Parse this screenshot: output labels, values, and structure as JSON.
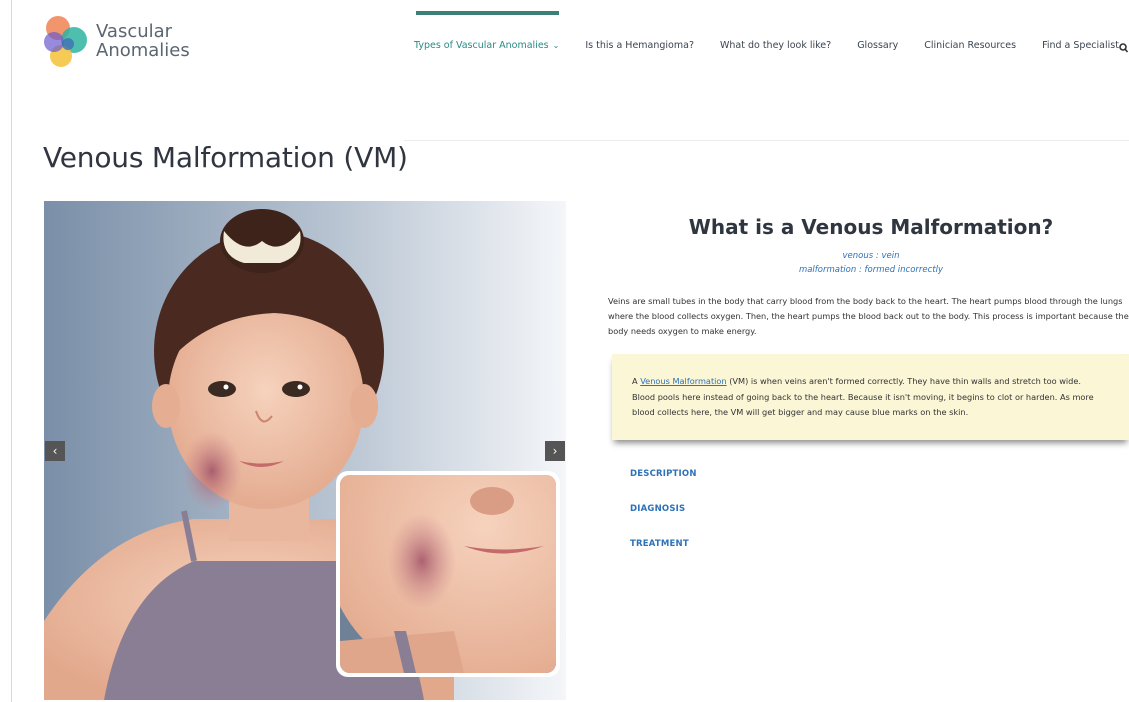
{
  "brand": {
    "line1": "Vascular",
    "line2": "Anomalies"
  },
  "nav": {
    "items": [
      {
        "label": "Types of Vascular Anomalies",
        "active": true,
        "has_caret": true
      },
      {
        "label": "Is this a Hemangioma?"
      },
      {
        "label": "What do they look like?"
      },
      {
        "label": "Glossary"
      },
      {
        "label": "Clinician Resources"
      },
      {
        "label": "Find a Specialist"
      }
    ],
    "search_icon": "search-icon",
    "caret": "⌄"
  },
  "page": {
    "title": "Venous Malformation (VM)"
  },
  "carousel": {
    "prev": "‹",
    "next": "›"
  },
  "content": {
    "heading": "What is a Venous Malformation?",
    "definitions": [
      "venous : vein",
      "malformation : formed incorrectly"
    ],
    "intro": "Veins are small tubes in the body that carry blood from the body back to the heart. The heart pumps blood through the lungs where the blood collects oxygen. Then, the heart pumps the blood back out to the body. This process is important because the body needs oxygen to make energy.",
    "callout": {
      "prefix": "A ",
      "link": "Venous Malformation",
      "text": " (VM) is when veins aren't formed correctly. They have thin walls and stretch too wide. Blood pools here instead of going back to the heart. Because it isn't moving, it begins to clot or harden. As more blood collects here, the VM will get bigger and may cause blue marks on the skin."
    },
    "tabs": [
      "DESCRIPTION",
      "DIAGNOSIS",
      "TREATMENT"
    ]
  },
  "colors": {
    "accent": "#3c7f78",
    "link": "#2d72b8",
    "callout_bg": "#fbf6d6"
  }
}
